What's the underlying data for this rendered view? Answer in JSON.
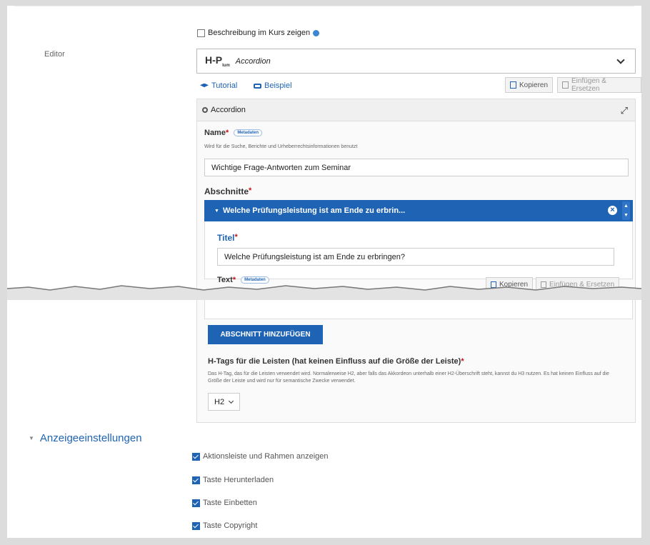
{
  "show_desc_label": "Beschreibung im Kurs zeigen",
  "editor_label": "Editor",
  "library": {
    "logo": "H-P",
    "logo_sub": "lum",
    "name": "Accordion"
  },
  "links": {
    "tutorial": "Tutorial",
    "example": "Beispiel"
  },
  "actions": {
    "copy": "Kopieren",
    "paste": "Einfügen & Ersetzen"
  },
  "panel": {
    "title": "Accordion"
  },
  "name_field": {
    "label": "Name",
    "meta_label": "Metadaten",
    "description": "Wird für die Suche, Berichte und Urheberrechtsinformationen benutzt",
    "value": "Wichtige Frage-Antworten zum Seminar"
  },
  "sections": {
    "label": "Abschnitte",
    "item_header": "Welche Prüfungsleistung ist am Ende zu erbrin...",
    "title_label": "Titel",
    "title_value": "Welche Prüfungsleistung ist am Ende zu erbringen?",
    "text_label": "Text",
    "text_meta": "Metadaten",
    "add_button": "ABSCHNITT HINZUFÜGEN"
  },
  "htag": {
    "label": "H-Tags für die Leisten (hat keinen Einfluss auf die Größe der Leiste)",
    "description": "Das H-Tag, das für die Leisten verwendet wird. Normalerweise H2, aber falls das Akkordeon unterhalb einer H2-Überschrift steht, kannst du H3 nutzen. Es hat keinen Einfluss auf die Größe der Leiste und wird nur für semantische Zwecke verwendet.",
    "value": "H2"
  },
  "display_settings": {
    "title": "Anzeigeeinstellungen",
    "options": [
      {
        "label": "Aktionsleiste und Rahmen anzeigen",
        "checked": true
      },
      {
        "label": "Taste Herunterladen",
        "checked": true
      },
      {
        "label": "Taste Einbetten",
        "checked": true
      },
      {
        "label": "Taste Copyright",
        "checked": true
      }
    ]
  }
}
